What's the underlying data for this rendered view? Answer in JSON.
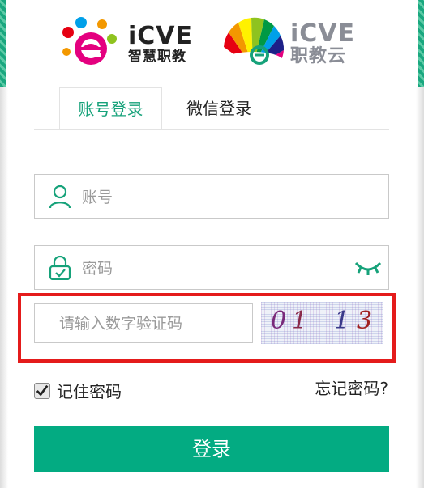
{
  "logos": {
    "zhihui": {
      "en": "iCVE",
      "cn": "智慧职教"
    },
    "yun": {
      "en": "iCVE",
      "cn": "职教云"
    }
  },
  "tabs": [
    {
      "label": "账号登录",
      "active": true
    },
    {
      "label": "微信登录",
      "active": false
    }
  ],
  "form": {
    "account_placeholder": "账号",
    "password_placeholder": "密码",
    "captcha_placeholder": "请输入数字验证码",
    "captcha_chars": [
      "0",
      "1",
      "1",
      "3"
    ],
    "remember_label": "记住密码",
    "remember_checked": true,
    "forgot_label": "忘记密码?",
    "login_label": "登录"
  },
  "colors": {
    "accent": "#03ab82",
    "highlight": "#e41b1b"
  },
  "icons": {
    "account": "user-icon",
    "password": "lock-icon",
    "eye": "eye-closed-icon",
    "checkbox": "check-icon"
  }
}
